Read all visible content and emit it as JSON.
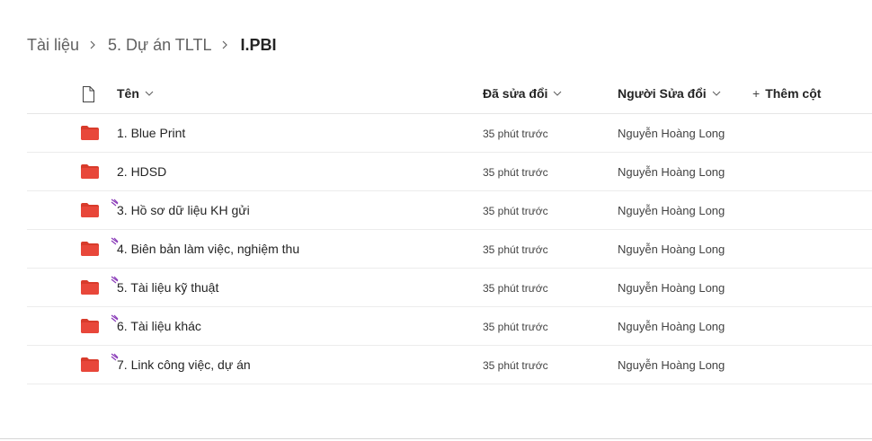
{
  "breadcrumb": {
    "items": [
      "Tài liệu",
      "5. Dự án TLTL",
      "I.PBI"
    ]
  },
  "columns": {
    "file_type_icon": "file-icon",
    "name": "Tên",
    "modified": "Đã sửa đổi",
    "modified_by": "Người Sửa đổi",
    "add_column": "Thêm cột",
    "add_column_plus": "+"
  },
  "colors": {
    "folder": "#d83b2b",
    "new_marker": "#8a3bb8"
  },
  "rows": [
    {
      "icon": "folder-icon",
      "is_new": false,
      "name": "1. Blue Print",
      "modified": "35 phút trước",
      "modified_by": "Nguyễn Hoàng Long"
    },
    {
      "icon": "folder-icon",
      "is_new": false,
      "name": "2. HDSD",
      "modified": "35 phút trước",
      "modified_by": "Nguyễn Hoàng Long"
    },
    {
      "icon": "folder-icon",
      "is_new": true,
      "name": "3. Hồ sơ dữ liệu KH gửi",
      "modified": "35 phút trước",
      "modified_by": "Nguyễn Hoàng Long"
    },
    {
      "icon": "folder-icon",
      "is_new": true,
      "name": "4. Biên bản làm việc, nghiệm thu",
      "modified": "35 phút trước",
      "modified_by": "Nguyễn Hoàng Long"
    },
    {
      "icon": "folder-icon",
      "is_new": true,
      "name": "5. Tài liệu kỹ thuật",
      "modified": "35 phút trước",
      "modified_by": "Nguyễn Hoàng Long"
    },
    {
      "icon": "folder-icon",
      "is_new": true,
      "name": "6. Tài liệu khác",
      "modified": "35 phút trước",
      "modified_by": "Nguyễn Hoàng Long"
    },
    {
      "icon": "folder-icon",
      "is_new": true,
      "name": "7. Link công việc, dự án",
      "modified": "35 phút trước",
      "modified_by": "Nguyễn Hoàng Long"
    }
  ]
}
